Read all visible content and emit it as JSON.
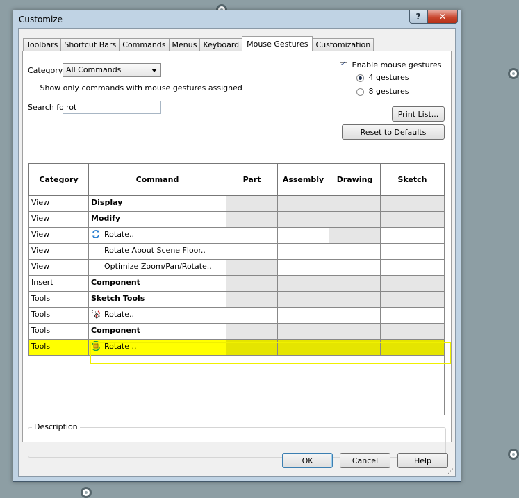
{
  "window": {
    "title": "Customize",
    "help_label": "?",
    "close_label": "✕"
  },
  "tabs": [
    "Toolbars",
    "Shortcut Bars",
    "Commands",
    "Menus",
    "Keyboard",
    "Mouse Gestures",
    "Customization"
  ],
  "active_tab": "Mouse Gestures",
  "category": {
    "label": "Category:",
    "value": "All Commands"
  },
  "show_only": {
    "label": "Show only commands with mouse gestures assigned",
    "checked": false
  },
  "search": {
    "label": "Search for:",
    "value": "rot"
  },
  "enable_gestures": {
    "label": "Enable mouse gestures",
    "checked": true
  },
  "gesture_options": [
    {
      "label": "4 gestures",
      "selected": true
    },
    {
      "label": "8 gestures",
      "selected": false
    }
  ],
  "buttons": {
    "print_list": "Print List...",
    "reset_defaults": "Reset to Defaults",
    "ok": "OK",
    "cancel": "Cancel",
    "help": "Help"
  },
  "table": {
    "headers": [
      "Category",
      "Command",
      "Part",
      "Assembly",
      "Drawing",
      "Sketch"
    ],
    "rows": [
      {
        "category": "View",
        "command": "Display",
        "bold": true,
        "indent": false,
        "icon": "",
        "shade": [
          true,
          true,
          true,
          true
        ]
      },
      {
        "category": "View",
        "command": "Modify",
        "bold": true,
        "indent": false,
        "icon": "",
        "shade": [
          true,
          true,
          true,
          true
        ]
      },
      {
        "category": "View",
        "command": "Rotate..",
        "bold": false,
        "indent": false,
        "icon": "rotate-view-icon",
        "shade": [
          false,
          false,
          true,
          false
        ]
      },
      {
        "category": "View",
        "command": "Rotate About Scene Floor..",
        "bold": false,
        "indent": true,
        "icon": "",
        "shade": [
          false,
          false,
          false,
          false
        ]
      },
      {
        "category": "View",
        "command": "Optimize Zoom/Pan/Rotate..",
        "bold": false,
        "indent": true,
        "icon": "",
        "shade": [
          true,
          false,
          false,
          false
        ]
      },
      {
        "category": "Insert",
        "command": "Component",
        "bold": true,
        "indent": false,
        "icon": "",
        "shade": [
          true,
          true,
          true,
          true
        ]
      },
      {
        "category": "Tools",
        "command": "Sketch Tools",
        "bold": true,
        "indent": false,
        "icon": "",
        "shade": [
          true,
          true,
          true,
          true
        ]
      },
      {
        "category": "Tools",
        "command": "Rotate..",
        "bold": false,
        "indent": false,
        "icon": "rotate-sketch-icon",
        "shade": [
          false,
          false,
          false,
          false
        ]
      },
      {
        "category": "Tools",
        "command": "Component",
        "bold": true,
        "indent": false,
        "icon": "",
        "shade": [
          true,
          true,
          true,
          true
        ]
      },
      {
        "category": "Tools",
        "command": "Rotate ..",
        "bold": false,
        "indent": false,
        "icon": "rotate-component-icon",
        "shade": [
          true,
          true,
          true,
          true
        ],
        "highlighted": true
      }
    ]
  },
  "description": {
    "label": "Description"
  },
  "colors": {
    "highlight": "#ffff00",
    "window_frame": "#c0d3e4",
    "background": "#8d9ea4"
  }
}
